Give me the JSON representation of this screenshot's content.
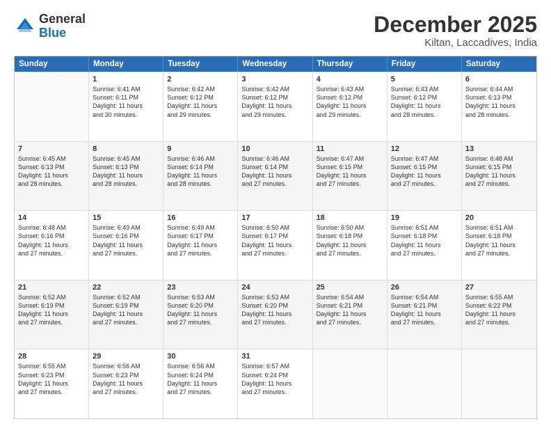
{
  "logo": {
    "general": "General",
    "blue": "Blue"
  },
  "title": "December 2025",
  "location": "Kiltan, Laccadives, India",
  "header_days": [
    "Sunday",
    "Monday",
    "Tuesday",
    "Wednesday",
    "Thursday",
    "Friday",
    "Saturday"
  ],
  "weeks": [
    {
      "shaded": false,
      "cells": [
        {
          "day": "",
          "lines": []
        },
        {
          "day": "1",
          "lines": [
            "Sunrise: 6:41 AM",
            "Sunset: 6:11 PM",
            "Daylight: 11 hours",
            "and 30 minutes."
          ]
        },
        {
          "day": "2",
          "lines": [
            "Sunrise: 6:42 AM",
            "Sunset: 6:12 PM",
            "Daylight: 11 hours",
            "and 29 minutes."
          ]
        },
        {
          "day": "3",
          "lines": [
            "Sunrise: 6:42 AM",
            "Sunset: 6:12 PM",
            "Daylight: 11 hours",
            "and 29 minutes."
          ]
        },
        {
          "day": "4",
          "lines": [
            "Sunrise: 6:43 AM",
            "Sunset: 6:12 PM",
            "Daylight: 11 hours",
            "and 29 minutes."
          ]
        },
        {
          "day": "5",
          "lines": [
            "Sunrise: 6:43 AM",
            "Sunset: 6:12 PM",
            "Daylight: 11 hours",
            "and 28 minutes."
          ]
        },
        {
          "day": "6",
          "lines": [
            "Sunrise: 6:44 AM",
            "Sunset: 6:13 PM",
            "Daylight: 11 hours",
            "and 28 minutes."
          ]
        }
      ]
    },
    {
      "shaded": true,
      "cells": [
        {
          "day": "7",
          "lines": [
            "Sunrise: 6:45 AM",
            "Sunset: 6:13 PM",
            "Daylight: 11 hours",
            "and 28 minutes."
          ]
        },
        {
          "day": "8",
          "lines": [
            "Sunrise: 6:45 AM",
            "Sunset: 6:13 PM",
            "Daylight: 11 hours",
            "and 28 minutes."
          ]
        },
        {
          "day": "9",
          "lines": [
            "Sunrise: 6:46 AM",
            "Sunset: 6:14 PM",
            "Daylight: 11 hours",
            "and 28 minutes."
          ]
        },
        {
          "day": "10",
          "lines": [
            "Sunrise: 6:46 AM",
            "Sunset: 6:14 PM",
            "Daylight: 11 hours",
            "and 27 minutes."
          ]
        },
        {
          "day": "11",
          "lines": [
            "Sunrise: 6:47 AM",
            "Sunset: 6:15 PM",
            "Daylight: 11 hours",
            "and 27 minutes."
          ]
        },
        {
          "day": "12",
          "lines": [
            "Sunrise: 6:47 AM",
            "Sunset: 6:15 PM",
            "Daylight: 11 hours",
            "and 27 minutes."
          ]
        },
        {
          "day": "13",
          "lines": [
            "Sunrise: 6:48 AM",
            "Sunset: 6:15 PM",
            "Daylight: 11 hours",
            "and 27 minutes."
          ]
        }
      ]
    },
    {
      "shaded": false,
      "cells": [
        {
          "day": "14",
          "lines": [
            "Sunrise: 6:48 AM",
            "Sunset: 6:16 PM",
            "Daylight: 11 hours",
            "and 27 minutes."
          ]
        },
        {
          "day": "15",
          "lines": [
            "Sunrise: 6:49 AM",
            "Sunset: 6:16 PM",
            "Daylight: 11 hours",
            "and 27 minutes."
          ]
        },
        {
          "day": "16",
          "lines": [
            "Sunrise: 6:49 AM",
            "Sunset: 6:17 PM",
            "Daylight: 11 hours",
            "and 27 minutes."
          ]
        },
        {
          "day": "17",
          "lines": [
            "Sunrise: 6:50 AM",
            "Sunset: 6:17 PM",
            "Daylight: 11 hours",
            "and 27 minutes."
          ]
        },
        {
          "day": "18",
          "lines": [
            "Sunrise: 6:50 AM",
            "Sunset: 6:18 PM",
            "Daylight: 11 hours",
            "and 27 minutes."
          ]
        },
        {
          "day": "19",
          "lines": [
            "Sunrise: 6:51 AM",
            "Sunset: 6:18 PM",
            "Daylight: 11 hours",
            "and 27 minutes."
          ]
        },
        {
          "day": "20",
          "lines": [
            "Sunrise: 6:51 AM",
            "Sunset: 6:18 PM",
            "Daylight: 11 hours",
            "and 27 minutes."
          ]
        }
      ]
    },
    {
      "shaded": true,
      "cells": [
        {
          "day": "21",
          "lines": [
            "Sunrise: 6:52 AM",
            "Sunset: 6:19 PM",
            "Daylight: 11 hours",
            "and 27 minutes."
          ]
        },
        {
          "day": "22",
          "lines": [
            "Sunrise: 6:52 AM",
            "Sunset: 6:19 PM",
            "Daylight: 11 hours",
            "and 27 minutes."
          ]
        },
        {
          "day": "23",
          "lines": [
            "Sunrise: 6:53 AM",
            "Sunset: 6:20 PM",
            "Daylight: 11 hours",
            "and 27 minutes."
          ]
        },
        {
          "day": "24",
          "lines": [
            "Sunrise: 6:53 AM",
            "Sunset: 6:20 PM",
            "Daylight: 11 hours",
            "and 27 minutes."
          ]
        },
        {
          "day": "25",
          "lines": [
            "Sunrise: 6:54 AM",
            "Sunset: 6:21 PM",
            "Daylight: 11 hours",
            "and 27 minutes."
          ]
        },
        {
          "day": "26",
          "lines": [
            "Sunrise: 6:54 AM",
            "Sunset: 6:21 PM",
            "Daylight: 11 hours",
            "and 27 minutes."
          ]
        },
        {
          "day": "27",
          "lines": [
            "Sunrise: 6:55 AM",
            "Sunset: 6:22 PM",
            "Daylight: 11 hours",
            "and 27 minutes."
          ]
        }
      ]
    },
    {
      "shaded": false,
      "cells": [
        {
          "day": "28",
          "lines": [
            "Sunrise: 6:55 AM",
            "Sunset: 6:23 PM",
            "Daylight: 11 hours",
            "and 27 minutes."
          ]
        },
        {
          "day": "29",
          "lines": [
            "Sunrise: 6:56 AM",
            "Sunset: 6:23 PM",
            "Daylight: 11 hours",
            "and 27 minutes."
          ]
        },
        {
          "day": "30",
          "lines": [
            "Sunrise: 6:56 AM",
            "Sunset: 6:24 PM",
            "Daylight: 11 hours",
            "and 27 minutes."
          ]
        },
        {
          "day": "31",
          "lines": [
            "Sunrise: 6:57 AM",
            "Sunset: 6:24 PM",
            "Daylight: 11 hours",
            "and 27 minutes."
          ]
        },
        {
          "day": "",
          "lines": []
        },
        {
          "day": "",
          "lines": []
        },
        {
          "day": "",
          "lines": []
        }
      ]
    }
  ]
}
